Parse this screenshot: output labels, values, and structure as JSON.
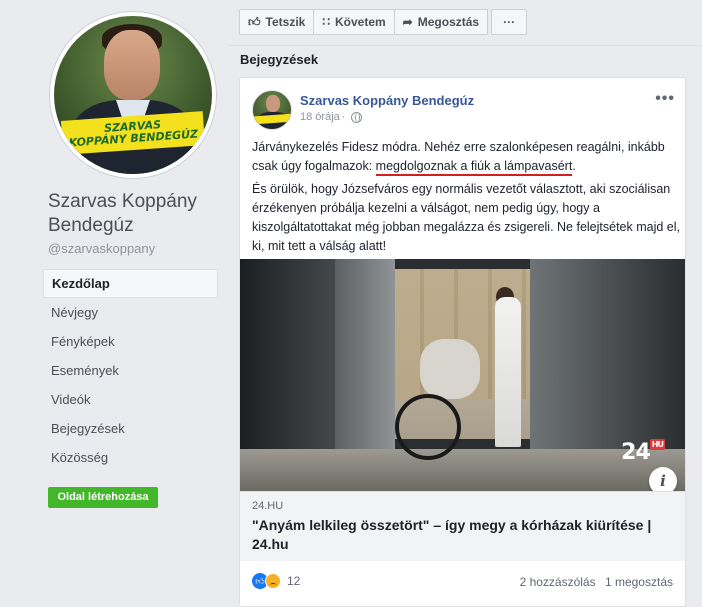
{
  "profile": {
    "name": "Szarvas Koppány Bendegúz",
    "handle": "@szarvaskoppany",
    "banner_line1": "SZARVAS",
    "banner_line2": "KOPPÁNY BENDEGÚZ"
  },
  "nav": {
    "items": [
      {
        "label": "Kezdőlap",
        "active": true
      },
      {
        "label": "Névjegy"
      },
      {
        "label": "Fényképek"
      },
      {
        "label": "Események"
      },
      {
        "label": "Videók"
      },
      {
        "label": "Bejegyzések"
      },
      {
        "label": "Közösség"
      }
    ],
    "create_label": "Oldal létrehozása"
  },
  "actions": {
    "like_label": "Tetszik",
    "follow_label": "Követem",
    "share_label": "Megosztás",
    "more_label": "···"
  },
  "section_title": "Bejegyzések",
  "post": {
    "author": "Szarvas Koppány Bendegúz",
    "time": "18 órája",
    "more": "•••",
    "p1_before": "Járványkezelés Fidesz módra. Nehéz erre szalonképesen reagálni, inkább csak úgy fogalmazok: ",
    "p1_underlined": "megdolgoznak a fiúk a lámpavasért",
    "p1_after": ".",
    "p2": "És örülök, hogy Józsefváros egy normális vezetőt választott, aki szociálisan érzékenyen próbálja kezelni a válságot, nem pedig úgy, hogy a kiszolgáltatottakat még jobban megalázza és zsigereli. Ne felejtsétek majd el, ki, mit tett a válság alatt!",
    "image_logo": "24",
    "image_logo_badge": "HU",
    "info_icon": "i",
    "link_domain": "24.HU",
    "link_title": "\"Anyám lelkileg összetört\" – így megy a kórházak kiürítése | 24.hu",
    "reaction_count": "12",
    "comments": "2 hozzászólás",
    "shares": "1 megosztás"
  },
  "colors": {
    "link_blue": "#365899",
    "create_green": "#42b72a",
    "underline_red": "#d21f1f"
  }
}
